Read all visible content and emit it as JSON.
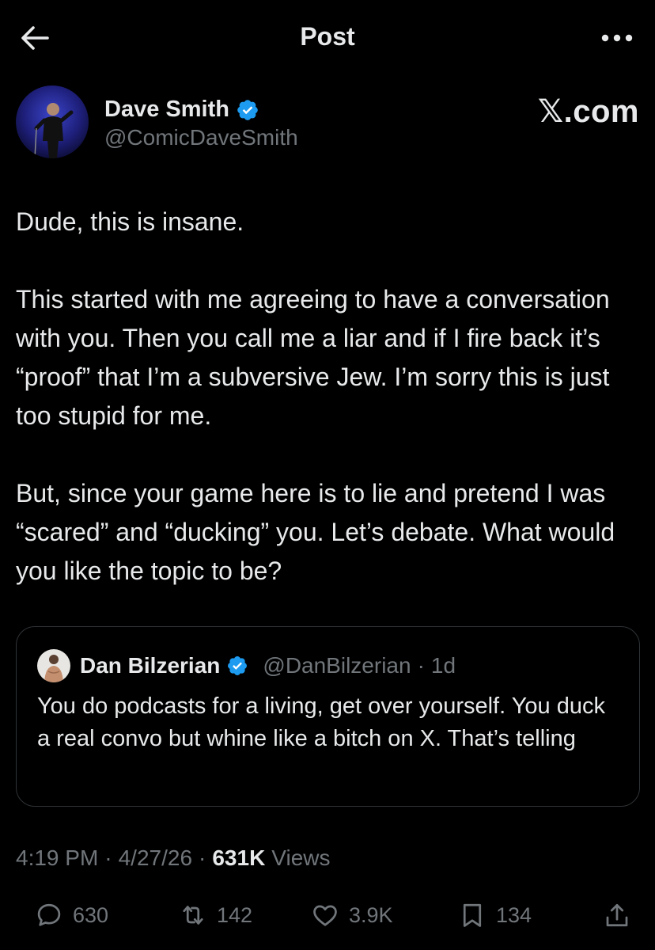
{
  "header": {
    "title": "Post",
    "back_icon": "arrow-left-icon",
    "more_icon": "more-horizontal-icon"
  },
  "author": {
    "display_name": "Dave Smith",
    "handle": "@ComicDaveSmith",
    "verified": true,
    "brand_mark": "𝕏.com"
  },
  "tweet": {
    "paragraphs": [
      "Dude, this is insane.",
      "This started with me agreeing to have a conversation with you. Then you call me a liar and if I fire back it’s “proof” that I’m a subversive Jew. I’m sorry this is just too stupid for me.",
      "But, since your game here is to lie and pretend I was “scared” and “ducking” you. Let’s debate. What would you like the topic to be?"
    ]
  },
  "quote": {
    "display_name": "Dan Bilzerian",
    "handle": "@DanBilzerian",
    "separator": "·",
    "time": "1d",
    "verified": true,
    "text": "You do podcasts for a living, get over yourself. You duck a real convo but whine like a bitch on X. That’s telling"
  },
  "meta": {
    "time": "4:19 PM",
    "sep1": "·",
    "date": "4/27/26",
    "sep2": "·",
    "views_count": "631K",
    "views_label": "Views"
  },
  "actions": {
    "reply": "630",
    "repost": "142",
    "like": "3.9K",
    "bookmark": "134"
  },
  "colors": {
    "background": "#000000",
    "text": "#e7e9ea",
    "muted": "#71767b",
    "verified": "#1d9bf0",
    "border": "#2f3336"
  }
}
